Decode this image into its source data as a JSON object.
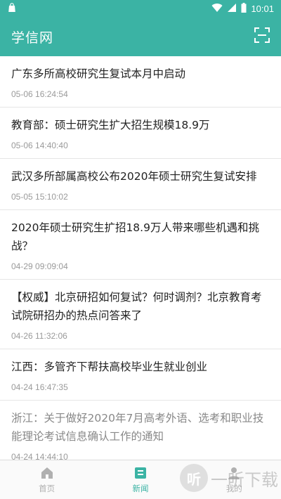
{
  "status_bar": {
    "time": "10:01",
    "icons": [
      "shopping-bag-icon",
      "wifi-icon",
      "cellular-signal-icon",
      "battery-icon"
    ]
  },
  "app_bar": {
    "title": "学信网",
    "action_icon": "scan-icon"
  },
  "news": [
    {
      "title": "广东多所高校研究生复试本月中启动",
      "time": "05-06 16:24:54",
      "read": false
    },
    {
      "title": "教育部：硕士研究生扩大招生规模18.9万",
      "time": "05-06 14:40:40",
      "read": false
    },
    {
      "title": "武汉多所部属高校公布2020年硕士研究生复试安排",
      "time": "05-05 15:10:02",
      "read": false
    },
    {
      "title": "2020年硕士研究生扩招18.9万人带来哪些机遇和挑战？",
      "time": "04-29 09:09:04",
      "read": false
    },
    {
      "title": "【权威】北京研招如何复试？何时调剂？北京教育考试院研招办的热点问答来了",
      "time": "04-26 11:32:06",
      "read": false
    },
    {
      "title": "江西：多管齐下帮扶高校毕业生就业创业",
      "time": "04-24 16:47:35",
      "read": false
    },
    {
      "title": "浙江：关于做好2020年7月高考外语、选考和职业技能理论考试信息确认工作的通知",
      "time": "04-24 14:44:10",
      "read": true
    }
  ],
  "tabs": [
    {
      "label": "首页",
      "icon": "home-icon",
      "active": false
    },
    {
      "label": "新闻",
      "icon": "news-icon",
      "active": true
    },
    {
      "label": "我的",
      "icon": "person-icon",
      "active": false
    }
  ],
  "watermark": {
    "logo_text": "听",
    "text": "一听下载"
  },
  "colors": {
    "accent": "#3bb3a4",
    "text": "#222222",
    "muted": "#9a9a9a"
  }
}
